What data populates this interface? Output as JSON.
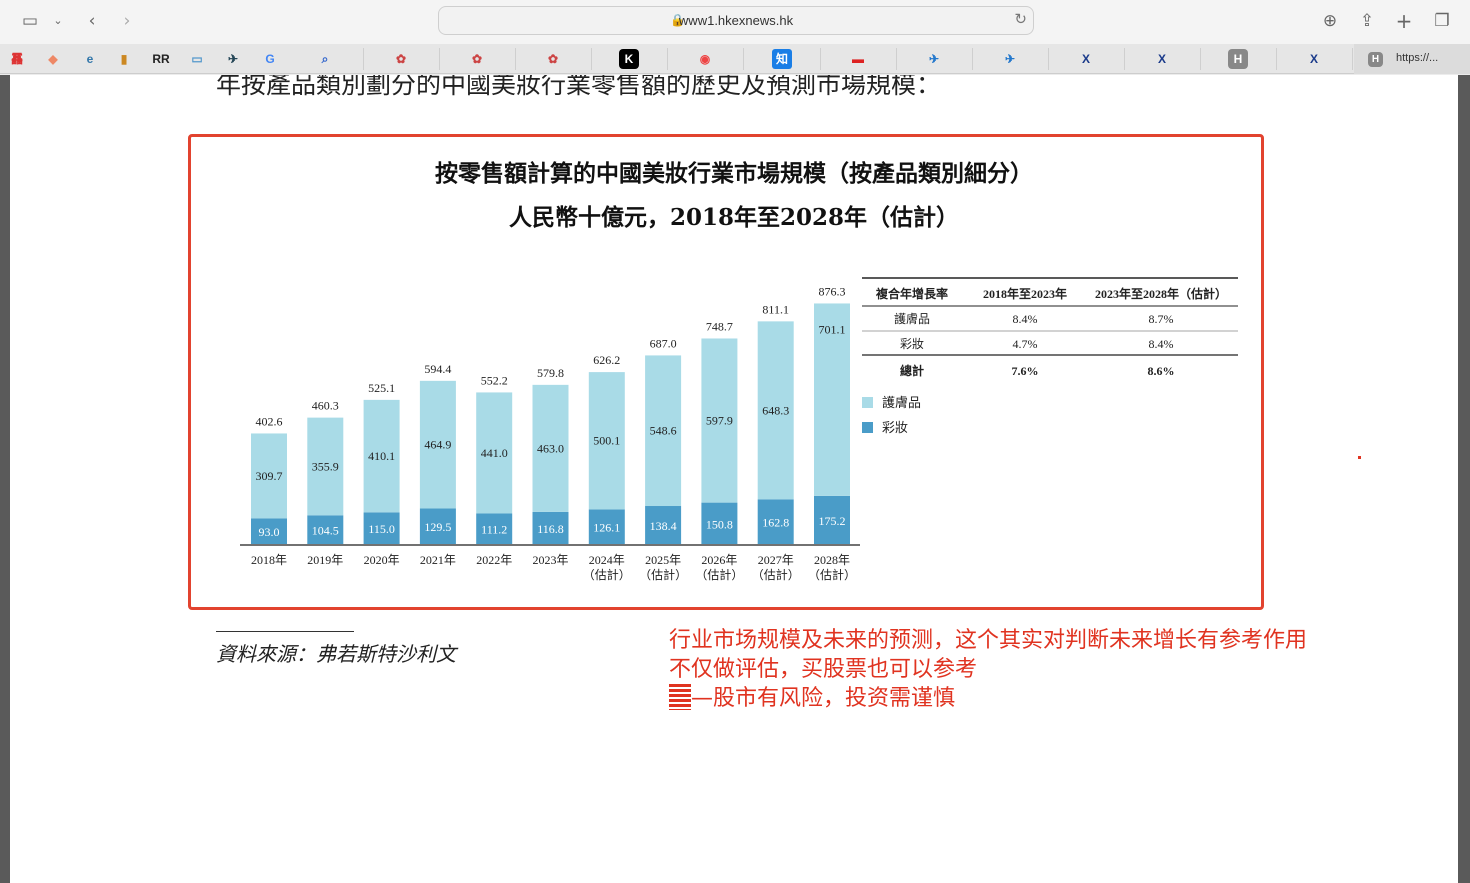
{
  "browser": {
    "url": "www1.hkexnews.hk",
    "last_tab_label": "https://..."
  },
  "tabs": [
    {
      "icon": "tab-favicon-1",
      "glyph": "靐"
    },
    {
      "icon": "tab-favicon-2",
      "glyph": "◆"
    },
    {
      "icon": "tab-favicon-3",
      "glyph": "e"
    },
    {
      "icon": "tab-favicon-4",
      "glyph": "▮"
    },
    {
      "icon": "tab-favicon-rr",
      "glyph": "RR"
    },
    {
      "icon": "tab-favicon-6",
      "glyph": "▭"
    },
    {
      "icon": "tab-favicon-7",
      "glyph": "✈"
    },
    {
      "icon": "google-icon",
      "glyph": "G"
    },
    {
      "icon": "search-icon",
      "glyph": "⌕"
    },
    {
      "icon": "tab-favicon-hk1",
      "glyph": "✿"
    },
    {
      "icon": "tab-favicon-hk2",
      "glyph": "✿"
    },
    {
      "icon": "tab-favicon-hk3",
      "glyph": "✿"
    },
    {
      "icon": "tab-favicon-k",
      "glyph": "K"
    },
    {
      "icon": "weibo-icon",
      "glyph": "◉"
    },
    {
      "icon": "zhihu-icon",
      "glyph": "知"
    },
    {
      "icon": "tab-favicon-red",
      "glyph": "▬"
    },
    {
      "icon": "tab-favicon-plane1",
      "glyph": "✈"
    },
    {
      "icon": "tab-favicon-plane2",
      "glyph": "✈"
    },
    {
      "icon": "tab-favicon-x1",
      "glyph": "X"
    },
    {
      "icon": "tab-favicon-x2",
      "glyph": "X"
    },
    {
      "icon": "tab-favicon-h",
      "glyph": "H"
    },
    {
      "icon": "tab-favicon-x3",
      "glyph": "X"
    }
  ],
  "page": {
    "cut_heading": "年按產品類別劃分的中國美妝行業零售額的歷史及預測市場規模：",
    "source": "資料來源：弗若斯特沙利文",
    "notes": [
      "行业市场规模及未来的预测，这个其实对判断未来增长有参考作用",
      "不仅做评估，买股票也可以参考",
      "—股市有风险，投资需谨慎"
    ]
  },
  "chart_data": {
    "type": "bar",
    "stacked": true,
    "title": "按零售額計算的中國美妝行業市場規模（按產品類別細分）",
    "subtitle": "人民幣十億元，2018年至2028年（估計）",
    "categories": [
      "2018年",
      "2019年",
      "2020年",
      "2021年",
      "2022年",
      "2023年",
      "2024年",
      "2025年",
      "2026年",
      "2027年",
      "2028年"
    ],
    "category_sublabels": [
      "",
      "",
      "",
      "",
      "",
      "",
      "（估計）",
      "（估計）",
      "（估計）",
      "（估計）",
      "（估計）"
    ],
    "series": [
      {
        "name": "彩妝",
        "color": "#4a9cc8",
        "values": [
          93.0,
          104.5,
          115.0,
          129.5,
          111.2,
          116.8,
          126.1,
          138.4,
          150.8,
          162.8,
          175.2
        ]
      },
      {
        "name": "護膚品",
        "color": "#a9dbe7",
        "values": [
          309.7,
          355.9,
          410.1,
          464.9,
          441.0,
          463.0,
          500.1,
          548.6,
          597.9,
          648.3,
          701.1
        ]
      }
    ],
    "totals": [
      402.6,
      460.3,
      525.1,
      594.4,
      552.2,
      579.8,
      626.2,
      687.0,
      748.7,
      811.1,
      876.3
    ],
    "legend_position": "right",
    "cagr_table": {
      "headers": [
        "複合年增長率",
        "2018年至2023年",
        "2023年至2028年（估計）"
      ],
      "rows": [
        [
          "護膚品",
          "8.4%",
          "8.7%"
        ],
        [
          "彩妝",
          "4.7%",
          "8.4%"
        ],
        [
          "總計",
          "7.6%",
          "8.6%"
        ]
      ]
    }
  }
}
